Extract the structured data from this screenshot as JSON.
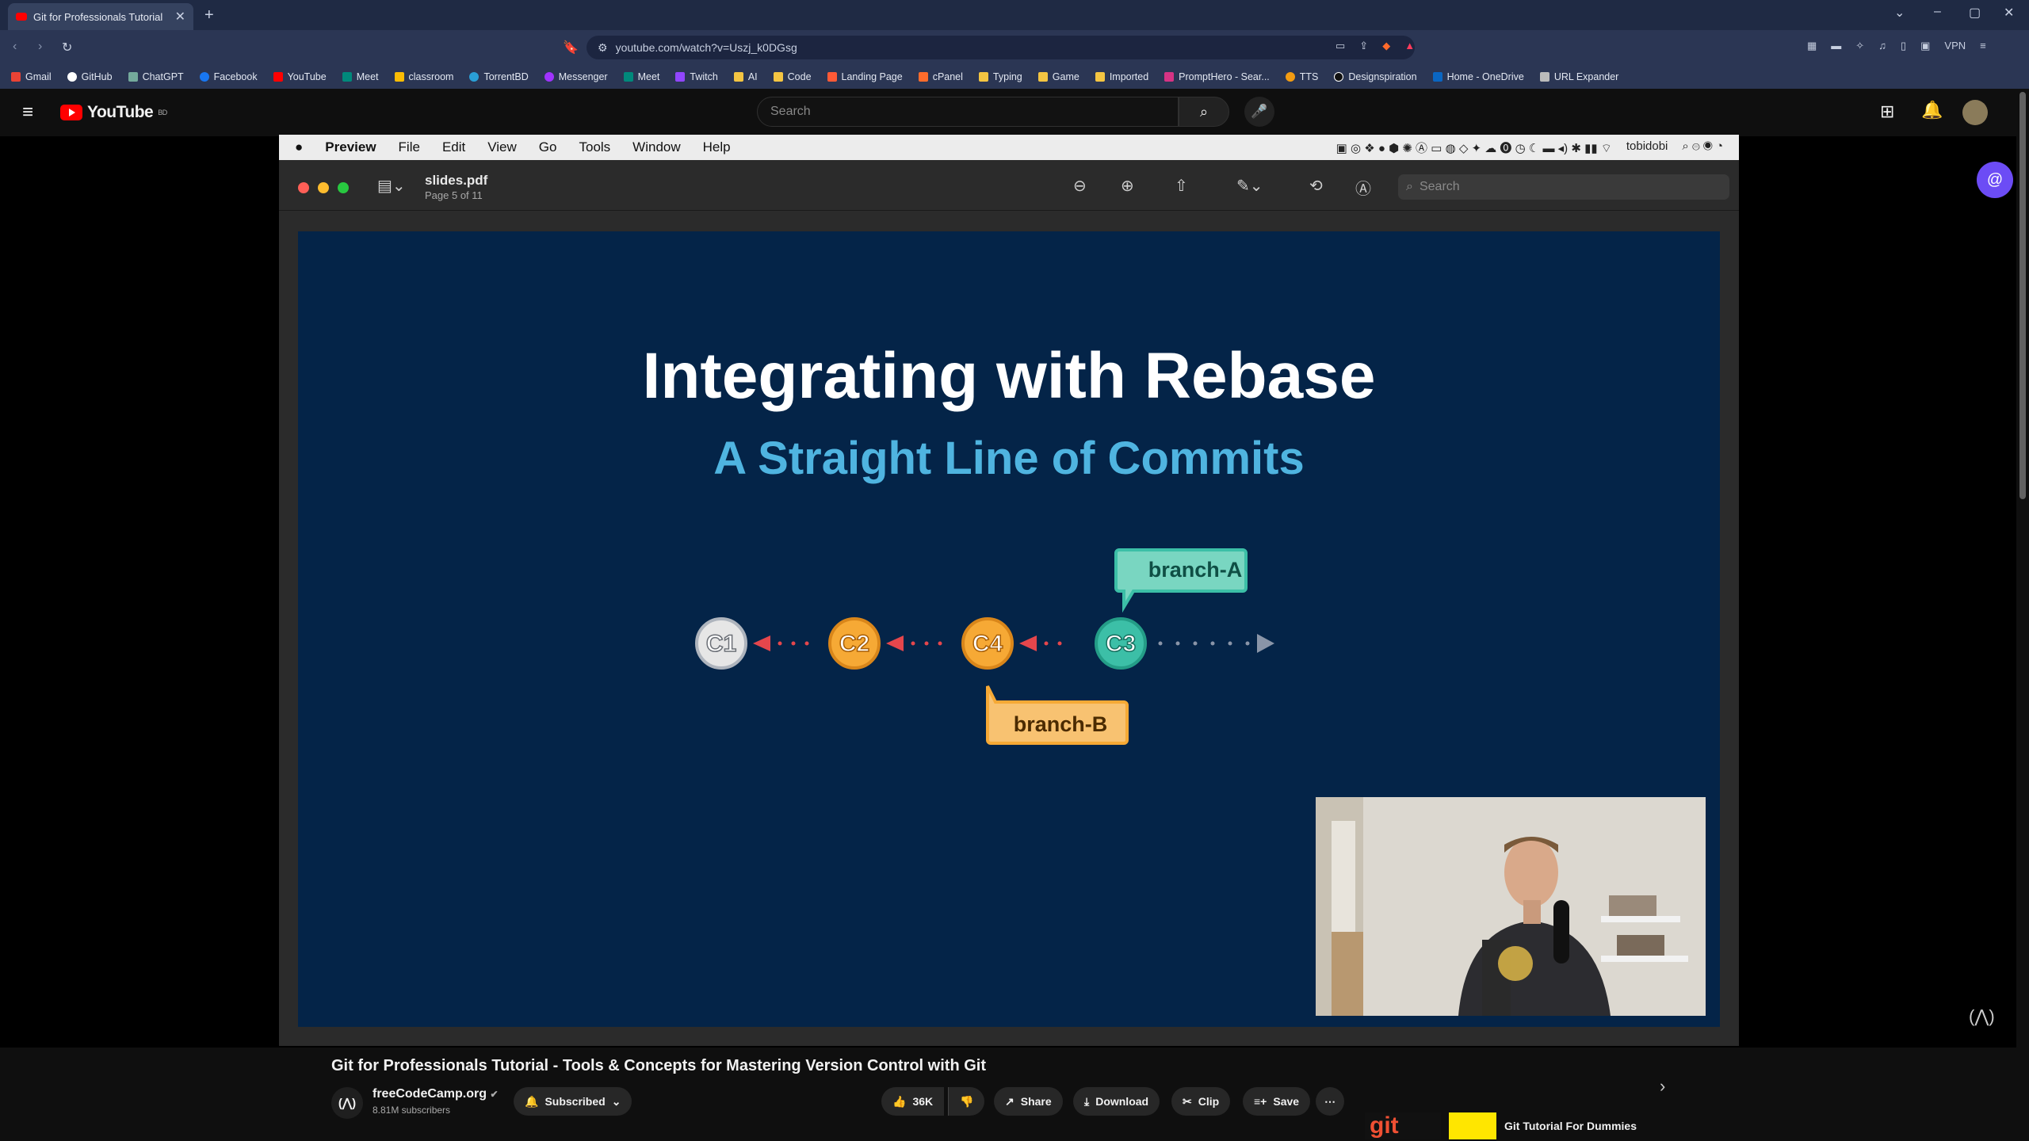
{
  "browser": {
    "tab_title": "Git for Professionals Tutorial",
    "url": "youtube.com/watch?v=Uszj_k0DGsg",
    "vpn_label": "VPN",
    "bookmarks": [
      "Gmail",
      "GitHub",
      "ChatGPT",
      "Facebook",
      "YouTube",
      "Meet",
      "classroom",
      "TorrentBD",
      "Messenger",
      "Meet",
      "Twitch",
      "AI",
      "Code",
      "Landing Page",
      "cPanel",
      "Typing",
      "Game",
      "Imported",
      "PromptHero - Sear...",
      "TTS",
      "Designspiration",
      "Home - OneDrive",
      "URL Expander"
    ]
  },
  "youtube": {
    "logo_text": "YouTube",
    "region": "BD",
    "search_placeholder": "Search"
  },
  "mac": {
    "menus": [
      "Preview",
      "File",
      "Edit",
      "View",
      "Go",
      "Tools",
      "Window",
      "Help"
    ],
    "user": "tobidobi",
    "pdf_title": "slides.pdf",
    "pdf_page": "Page 5 of 11",
    "search_placeholder": "Search"
  },
  "slide": {
    "title": "Integrating with Rebase",
    "subtitle": "A Straight Line of Commits",
    "commits": [
      "C1",
      "C2",
      "C4",
      "C3"
    ],
    "branch_a": "branch-A",
    "branch_b": "branch-B",
    "colors": {
      "bg": "#042448",
      "grey": "#e6e6e6",
      "orange": "#f6a935",
      "teal": "#3cbfa7",
      "arrow": "#e5464c"
    }
  },
  "video": {
    "title": "Git for Professionals Tutorial - Tools & Concepts for Mastering Version Control with Git",
    "channel": "freeCodeCamp.org",
    "subscribers": "8.81M subscribers",
    "subscribed_label": "Subscribed",
    "likes": "36K",
    "share": "Share",
    "download": "Download",
    "clip": "Clip",
    "save": "Save"
  },
  "recommendation": {
    "logo_text": "git",
    "title": "Git Tutorial For Dummies"
  }
}
